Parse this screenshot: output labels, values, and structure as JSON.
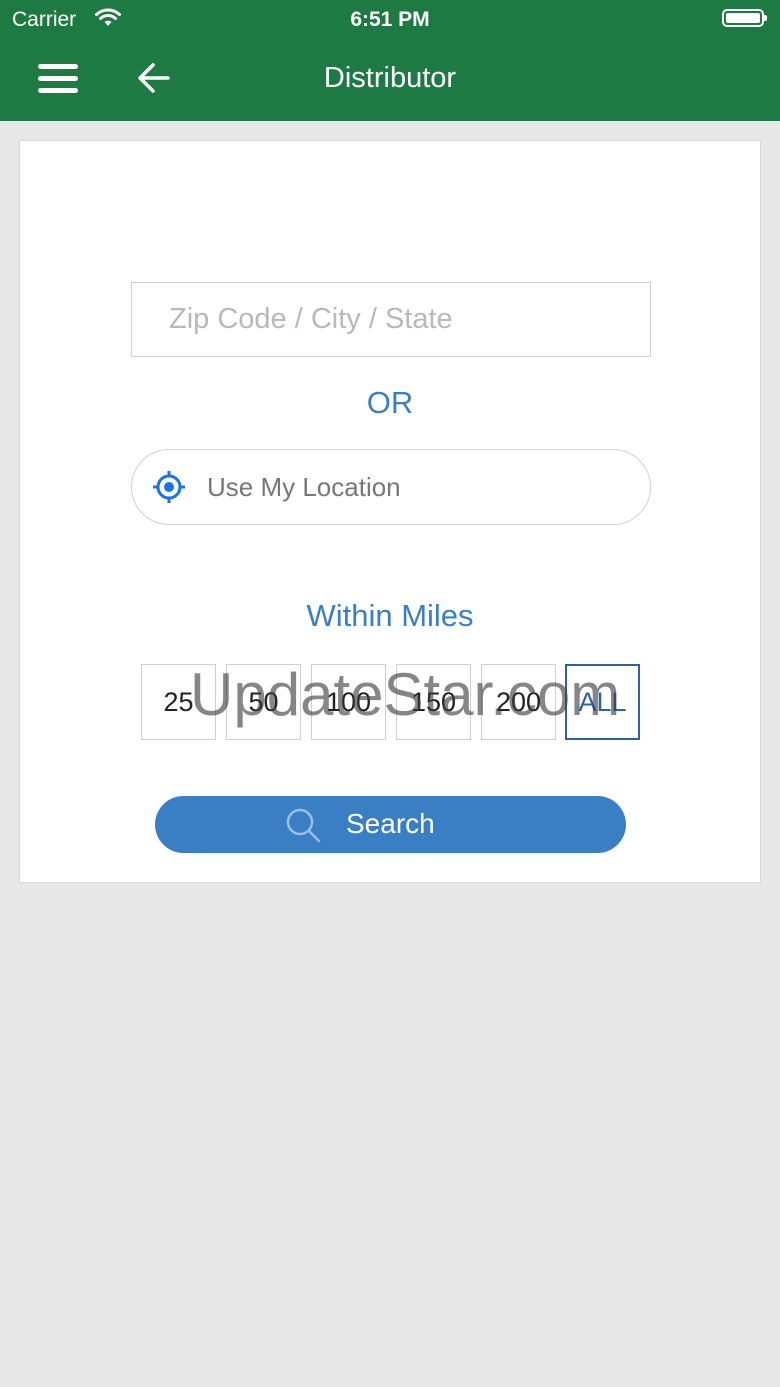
{
  "status_bar": {
    "carrier": "Carrier",
    "time": "6:51 PM"
  },
  "header": {
    "title": "Distributor"
  },
  "search_form": {
    "location_placeholder": "Zip Code / City / State",
    "location_value": "",
    "or_label": "OR",
    "use_location_label": "Use My Location",
    "within_miles_label": "Within Miles",
    "mile_options": [
      "25",
      "50",
      "100",
      "150",
      "200",
      "ALL"
    ],
    "selected_miles": "ALL",
    "search_label": "Search"
  },
  "watermark": "UpdateStar.com",
  "colors": {
    "header_bg": "#1e7a43",
    "accent": "#3a7fc4",
    "selected_border": "#2e5fa8",
    "page_bg": "#e8e8e8"
  },
  "icons": {
    "menu": "hamburger-icon",
    "back": "arrow-left-icon",
    "location": "crosshair-location-icon",
    "search": "magnifier-icon",
    "wifi": "wifi-icon",
    "battery": "battery-icon"
  }
}
